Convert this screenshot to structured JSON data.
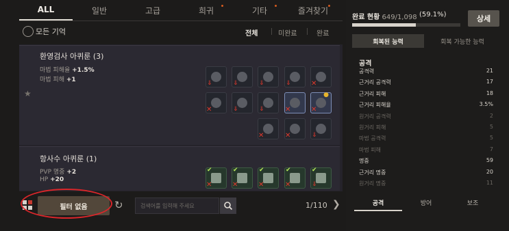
{
  "tabs": [
    {
      "label": "ALL",
      "active": true,
      "dot": false
    },
    {
      "label": "일반",
      "dot": false
    },
    {
      "label": "고급",
      "dot": false
    },
    {
      "label": "희귀",
      "dot": true
    },
    {
      "label": "기타",
      "dot": true
    },
    {
      "label": "즐겨찾기",
      "dot": true
    }
  ],
  "memory": {
    "title": "모든 기억",
    "filters": [
      "전체",
      "미완료",
      "완료"
    ]
  },
  "cards": [
    {
      "title": "환영검사 아퀴룬 (3)",
      "stats": [
        {
          "name": "마법 피해율",
          "value": "+1.5%"
        },
        {
          "name": "마법 피해",
          "value": "+1"
        }
      ]
    },
    {
      "title": "항사수 아퀴룬 (1)",
      "stats": [
        {
          "name": "PVP 명중",
          "value": "+2"
        },
        {
          "name": "HP",
          "value": "+20"
        }
      ]
    }
  ],
  "bottom": {
    "filter_label": "필터 없음",
    "search_placeholder": "검색어를 입력해 주세요",
    "pager": "1/110"
  },
  "progress": {
    "label": "완료 현황",
    "count": "649/1,098",
    "percent": "(59.1%)",
    "fraction": 0.591,
    "detail_label": "상세"
  },
  "right_tabs": [
    "회복된 능력",
    "회복 가능한 능력"
  ],
  "ability_category": "공격",
  "abilities": [
    {
      "name": "공격력",
      "value": "21",
      "dim": false
    },
    {
      "name": "근거리 공격력",
      "value": "17",
      "dim": false
    },
    {
      "name": "근거리 피해",
      "value": "18",
      "dim": false
    },
    {
      "name": "근거리 피해율",
      "value": "3.5%",
      "dim": false
    },
    {
      "name": "원거리 공격력",
      "value": "2",
      "dim": true
    },
    {
      "name": "원거리 피해",
      "value": "5",
      "dim": true
    },
    {
      "name": "마법 공격력",
      "value": "5",
      "dim": true
    },
    {
      "name": "마법 피해",
      "value": "7",
      "dim": true
    },
    {
      "name": "명중",
      "value": "59",
      "dim": false
    },
    {
      "name": "근거리 명중",
      "value": "20",
      "dim": false
    },
    {
      "name": "원거리 명중",
      "value": "11",
      "dim": true
    }
  ],
  "bottom_tabs": [
    "공격",
    "방어",
    "보조"
  ],
  "colors": {
    "accent_red": "#d9262a",
    "progress_fill": "#d8d3cb",
    "new_dot": "#d65b1f"
  }
}
